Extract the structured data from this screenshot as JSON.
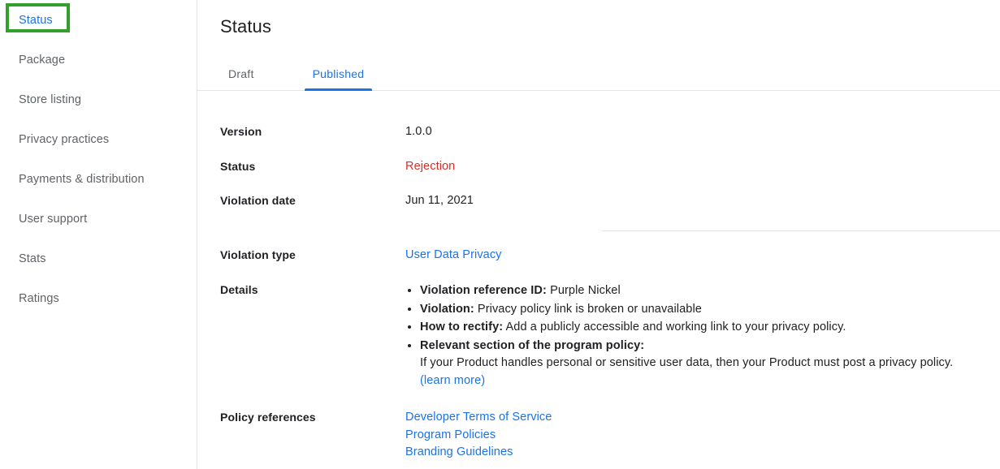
{
  "sidebar": {
    "items": [
      {
        "label": "Status",
        "active": true,
        "highlighted": true
      },
      {
        "label": "Package",
        "active": false,
        "highlighted": false
      },
      {
        "label": "Store listing",
        "active": false,
        "highlighted": false
      },
      {
        "label": "Privacy practices",
        "active": false,
        "highlighted": false
      },
      {
        "label": "Payments & distribution",
        "active": false,
        "highlighted": false
      },
      {
        "label": "User support",
        "active": false,
        "highlighted": false
      },
      {
        "label": "Stats",
        "active": false,
        "highlighted": false
      },
      {
        "label": "Ratings",
        "active": false,
        "highlighted": false
      }
    ]
  },
  "main": {
    "title": "Status",
    "tabs": [
      {
        "label": "Draft",
        "active": false
      },
      {
        "label": "Published",
        "active": true
      }
    ],
    "fields": {
      "version_label": "Version",
      "version_value": "1.0.0",
      "status_label": "Status",
      "status_value": "Rejection",
      "violation_date_label": "Violation date",
      "violation_date_value": "Jun 11, 2021",
      "violation_type_label": "Violation type",
      "violation_type_value": "User Data Privacy",
      "details_label": "Details",
      "policy_references_label": "Policy references"
    },
    "details": [
      {
        "strong": "Violation reference ID:",
        "text": " Purple Nickel"
      },
      {
        "strong": "Violation:",
        "text": " Privacy policy link is broken or unavailable"
      },
      {
        "strong": "How to rectify:",
        "text": " Add a publicly accessible and working link to your privacy policy."
      },
      {
        "strong": "Relevant section of the program policy:",
        "text": ""
      }
    ],
    "details_paragraph": "If your Product handles personal or sensitive user data, then your Product must post a privacy policy.",
    "learn_more_label": "(learn more)",
    "policy_references": [
      "Developer Terms of Service",
      "Program Policies",
      "Branding Guidelines"
    ]
  },
  "colors": {
    "accent_blue": "#1a73e8",
    "rejection_red": "#d93025",
    "highlight_green": "#33a02c",
    "text_primary": "#202124",
    "text_secondary": "#5f6368",
    "divider": "#e4e5e7"
  }
}
